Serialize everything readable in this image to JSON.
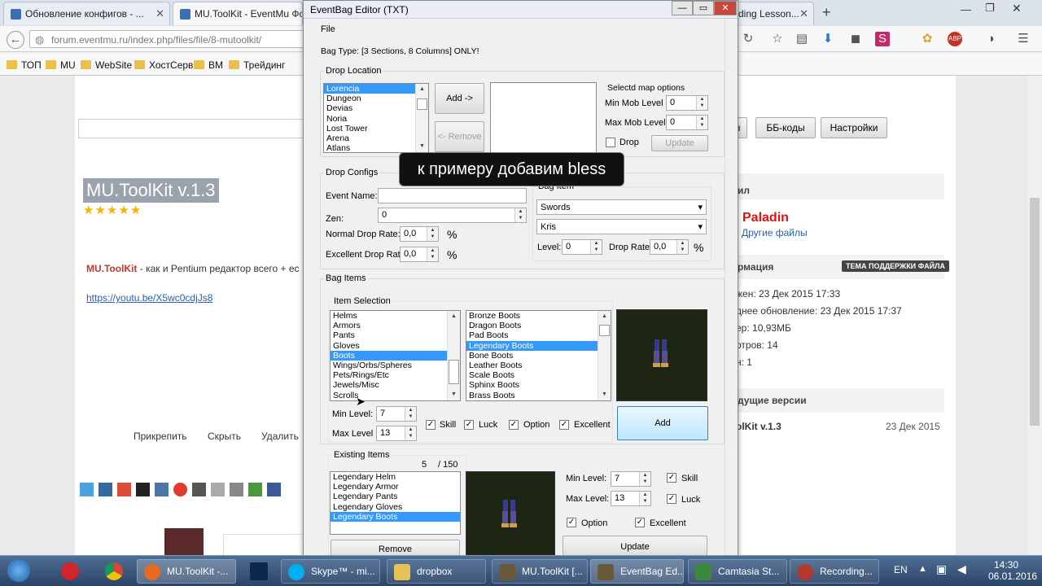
{
  "browser": {
    "tabs": [
      {
        "label": "Обновление конфигов - ..."
      },
      {
        "label": "MU.ToolKit - EventMu Фо"
      },
      {
        "label": "ding Lesson..."
      }
    ],
    "url": "forum.eventmu.ru/index.php/files/file/8-mutoolkit/",
    "bookmarks": [
      "ТОП",
      "MU",
      "WebSite",
      "ХостСерв",
      "BM",
      "Трейдинг"
    ]
  },
  "forum": {
    "title": "MU.ToolKit v.1.3",
    "description_bold": "MU.ToolKit",
    "description_rest": " - как и Pentium редактор всего + ес",
    "link": "https://youtu.be/X5wc0cdjJs8",
    "actions": [
      "Прикрепить",
      "Скрыть",
      "Удалить"
    ],
    "header_buttons": [
      "ы",
      "ББ-коды",
      "Настройки"
    ],
    "author_header": "ил",
    "author_name": "Paladin",
    "other_files": "Другие файлы",
    "info_header": "рмация",
    "support_badge": "ТЕМА ПОДДЕРЖКИ ФАЙЛА",
    "info_lines": [
      "жен: 23 Дек 2015 17:33",
      "днее обновление: 23 Дек 2015 17:37",
      "ер: 10,93МБ",
      "отров: 14",
      "н: 1"
    ],
    "prev_header": "дущие версии",
    "prev_name": "olKit v.1.3",
    "prev_date": "23 Дек 2015"
  },
  "dialog": {
    "title": "EventBag Editor (TXT)",
    "menu_file": "File",
    "bag_type": "Bag Type: [3 Sections, 8 Columns] ONLY!",
    "drop_location": {
      "legend": "Drop Location",
      "maps": [
        "Lorencia",
        "Dungeon",
        "Devias",
        "Noria",
        "Lost Tower",
        "Arena",
        "Atlans"
      ],
      "add_label": "Add ->",
      "remove_label": "<- Remove",
      "map_options": "Selectd map options",
      "min_mob_label": "Min Mob Level",
      "min_mob_value": "0",
      "max_mob_label": "Max Mob Level",
      "max_mob_value": "0",
      "drop_label": "Drop",
      "update_label": "Update"
    },
    "drop_configs": {
      "legend": "Drop Configs",
      "event_name_label": "Event Name:",
      "zen_label": "Zen:",
      "zen_value": "0",
      "normal_rate_label": "Normal Drop Rate:",
      "normal_rate_value": "0,0",
      "excellent_rate_label": "Excellent Drop Rate:",
      "excellent_rate_value": "0,0",
      "percent": "%",
      "bag_item_legend": "Bag Item",
      "category_value": "Swords",
      "item_value": "Kris",
      "level_label": "Level:",
      "level_value": "0",
      "drop_rate_label": "Drop Rate:",
      "drop_rate_value": "0,0"
    },
    "bag_items": {
      "legend": "Bag Items",
      "item_selection_legend": "Item Selection",
      "categories": [
        "Helms",
        "Armors",
        "Pants",
        "Gloves",
        "Boots",
        "Wings/Orbs/Spheres",
        "Pets/Rings/Etc",
        "Jewels/Misc",
        "Scrolls"
      ],
      "items": [
        "Bronze Boots",
        "Dragon Boots",
        "Pad Boots",
        "Legendary Boots",
        "Bone Boots",
        "Leather Boots",
        "Scale Boots",
        "Sphinx Boots",
        "Brass Boots"
      ],
      "min_level_label": "Min Level:",
      "min_level_value": "7",
      "max_level_label": "Max Level",
      "max_level_value": "13",
      "skill_label": "Skill",
      "luck_label": "Luck",
      "option_label": "Option",
      "excellent_label": "Excellent",
      "add_label": "Add"
    },
    "existing": {
      "legend": "Existing Items",
      "count": "5",
      "max": "/ 150",
      "items": [
        "Legendary Helm",
        "Legendary Armor",
        "Legendary Pants",
        "Legendary Gloves",
        "Legendary Boots"
      ],
      "remove_label": "Remove",
      "min_level_label": "Min Level:",
      "min_level_value": "7",
      "max_level_label": "Max Level:",
      "max_level_value": "13",
      "skill_label": "Skill",
      "luck_label": "Luck",
      "option_label": "Option",
      "excellent_label": "Excellent",
      "update_label": "Update"
    }
  },
  "tooltip": "к примеру добавим bless",
  "taskbar": {
    "items": [
      "MU.ToolKit -...",
      "Skype™ - mi...",
      "dropbox",
      "MU.ToolKit [...",
      "EventBag Ed...",
      "Camtasia St...",
      "Recording..."
    ],
    "lang": "EN",
    "time": "14:30",
    "date": "06.01.2016"
  },
  "colors": {
    "accent": "#3399ff",
    "taskbar": "#2b4466"
  }
}
